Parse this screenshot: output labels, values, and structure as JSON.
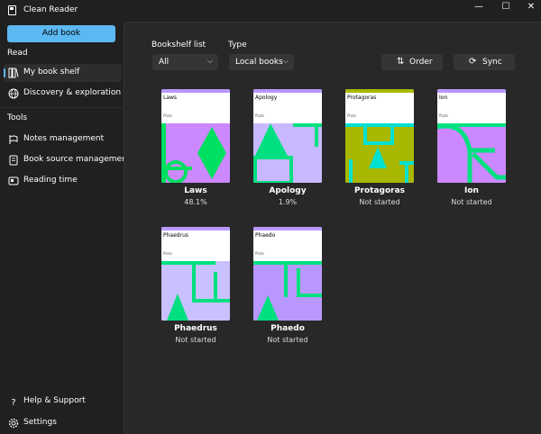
{
  "window": {
    "title": "Clean Reader",
    "minimize": "—",
    "maximize": "☐",
    "close": "✕"
  },
  "sidebar": {
    "add_button": "Add book",
    "read_section": "Read",
    "read_items": [
      {
        "label": "My book shelf",
        "icon": "bookshelf-icon",
        "active": true
      },
      {
        "label": "Discovery & exploration",
        "icon": "globe-icon",
        "active": false
      }
    ],
    "tools_section": "Tools",
    "tool_items": [
      {
        "label": "Notes management",
        "icon": "notes-icon"
      },
      {
        "label": "Book source management",
        "icon": "book-source-icon"
      },
      {
        "label": "Reading time",
        "icon": "reading-time-icon"
      }
    ],
    "bottom_items": [
      {
        "label": "Help & Support",
        "icon": "help-icon"
      },
      {
        "label": "Settings",
        "icon": "gear-icon"
      }
    ]
  },
  "toolbar": {
    "bookshelf_label": "Bookshelf list",
    "bookshelf_value": "All",
    "type_label": "Type",
    "type_value": "Local books",
    "order_label": "Order",
    "sync_label": "Sync"
  },
  "books": [
    {
      "title": "Laws",
      "cover_title": "Laws",
      "author": "Plato",
      "progress": "48.1%",
      "colors": {
        "bg": "#cc88ff",
        "fg": "#00e060"
      }
    },
    {
      "title": "Apology",
      "cover_title": "Apology",
      "author": "Plato",
      "progress": "1.9%",
      "colors": {
        "bg": "#c8b8ff",
        "fg": "#00e080"
      }
    },
    {
      "title": "Protagoras",
      "cover_title": "Protagoras",
      "author": "Plato",
      "progress": "Not started",
      "colors": {
        "bg": "#a8b800",
        "fg": "#00e0d0"
      }
    },
    {
      "title": "Ion",
      "cover_title": "Ion",
      "author": "Plato",
      "progress": "Not started",
      "colors": {
        "bg": "#cc88ff",
        "fg": "#00e080"
      }
    },
    {
      "title": "Phaedrus",
      "cover_title": "Phaedrus",
      "author": "Plato",
      "progress": "Not started",
      "colors": {
        "bg": "#c8c0ff",
        "fg": "#00e080"
      }
    },
    {
      "title": "Phaedo",
      "cover_title": "Phaedo",
      "author": "Plato",
      "progress": "Not started",
      "colors": {
        "bg": "#b898ff",
        "fg": "#00e080"
      }
    }
  ]
}
